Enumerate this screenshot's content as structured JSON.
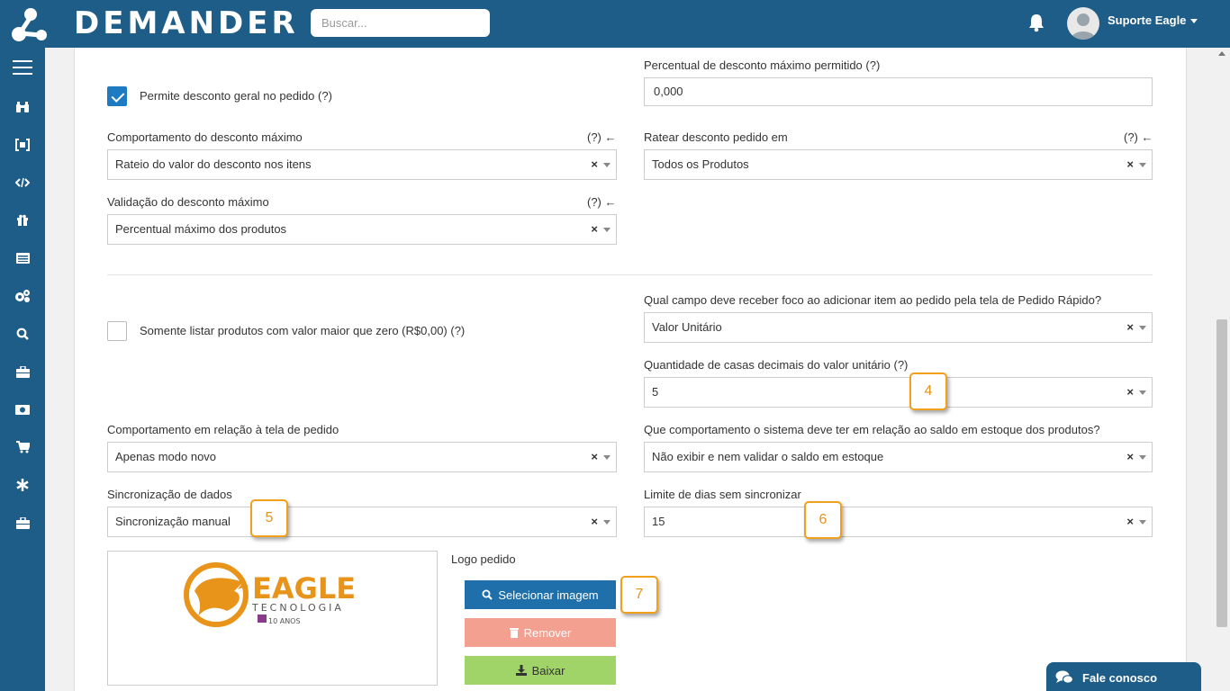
{
  "header": {
    "brand": "DEMANDER",
    "search_placeholder": "Buscar...",
    "user_name": "Suporte Eagle"
  },
  "sidebar": {
    "items": [
      {
        "icon": "menu-icon",
        "glyph": "☰"
      },
      {
        "icon": "binoculars-icon",
        "glyph": "⛊"
      },
      {
        "icon": "bracket-icon",
        "glyph": "{▪}"
      },
      {
        "icon": "code-icon",
        "glyph": "</>"
      },
      {
        "icon": "gift-icon",
        "glyph": "⊞"
      },
      {
        "icon": "list-icon",
        "glyph": "▤"
      },
      {
        "icon": "gears-icon",
        "glyph": "⚙"
      },
      {
        "icon": "search-icon",
        "glyph": "⚲"
      },
      {
        "icon": "briefcase-icon",
        "glyph": "▣"
      },
      {
        "icon": "money-icon",
        "glyph": "◙"
      },
      {
        "icon": "cart-icon",
        "glyph": "⛟"
      },
      {
        "icon": "asterisk-icon",
        "glyph": "✱"
      },
      {
        "icon": "briefcase-icon",
        "glyph": "▣"
      }
    ]
  },
  "form": {
    "desconto_geral_label": "Permite desconto geral no pedido (?)",
    "desconto_geral_checked": true,
    "percentual_label": "Percentual de desconto máximo permitido (?)",
    "percentual_value": "0,000",
    "comportamento_label": "Comportamento do desconto máximo",
    "comportamento_help": "(?) ←",
    "comportamento_value": "Rateio do valor do desconto nos itens",
    "ratear_label": "Ratear desconto pedido em",
    "ratear_help": "(?) ←",
    "ratear_value": "Todos os Produtos",
    "validacao_label": "Validação do desconto máximo",
    "validacao_help": "(?) ←",
    "validacao_value": "Percentual máximo dos produtos",
    "somente_listar_label": "Somente listar produtos com valor maior que zero (R$0,00) (?)",
    "somente_listar_checked": false,
    "foco_label": "Qual campo deve receber foco ao adicionar item ao pedido pela tela de Pedido Rápido?",
    "foco_value": "Valor Unitário",
    "casas_label": "Quantidade de casas decimais do valor unitário (?)",
    "casas_value": "5",
    "tela_pedido_label": "Comportamento em relação à tela de pedido",
    "tela_pedido_value": "Apenas modo novo",
    "estoque_label": "Que comportamento o sistema deve ter em relação ao saldo em estoque dos produtos?",
    "estoque_value": "Não exibir e nem validar o saldo em estoque",
    "sincronizacao_label": "Sincronização de dados",
    "sincronizacao_value": "Sincronização manual",
    "limite_label": "Limite de dias sem sincronizar",
    "limite_value": "15",
    "clear_symbol": "×",
    "logo_label": "Logo pedido",
    "logo_title": "EAGLE",
    "logo_subtitle": "TECNOLOGIA",
    "logo_anniv": "10 ANOS",
    "btn_select": "Selecionar imagem",
    "btn_remove": "Remover",
    "btn_download": "Baixar"
  },
  "badges": [
    "4",
    "5",
    "6",
    "7"
  ],
  "chat": {
    "label": "Fale conosco"
  },
  "colors": {
    "header": "#1e5d88",
    "primary": "#1f6fab",
    "danger": "#f4a091",
    "success": "#a0d468",
    "badge_border": "#f0a01c",
    "logo_orange": "#e8941a"
  }
}
